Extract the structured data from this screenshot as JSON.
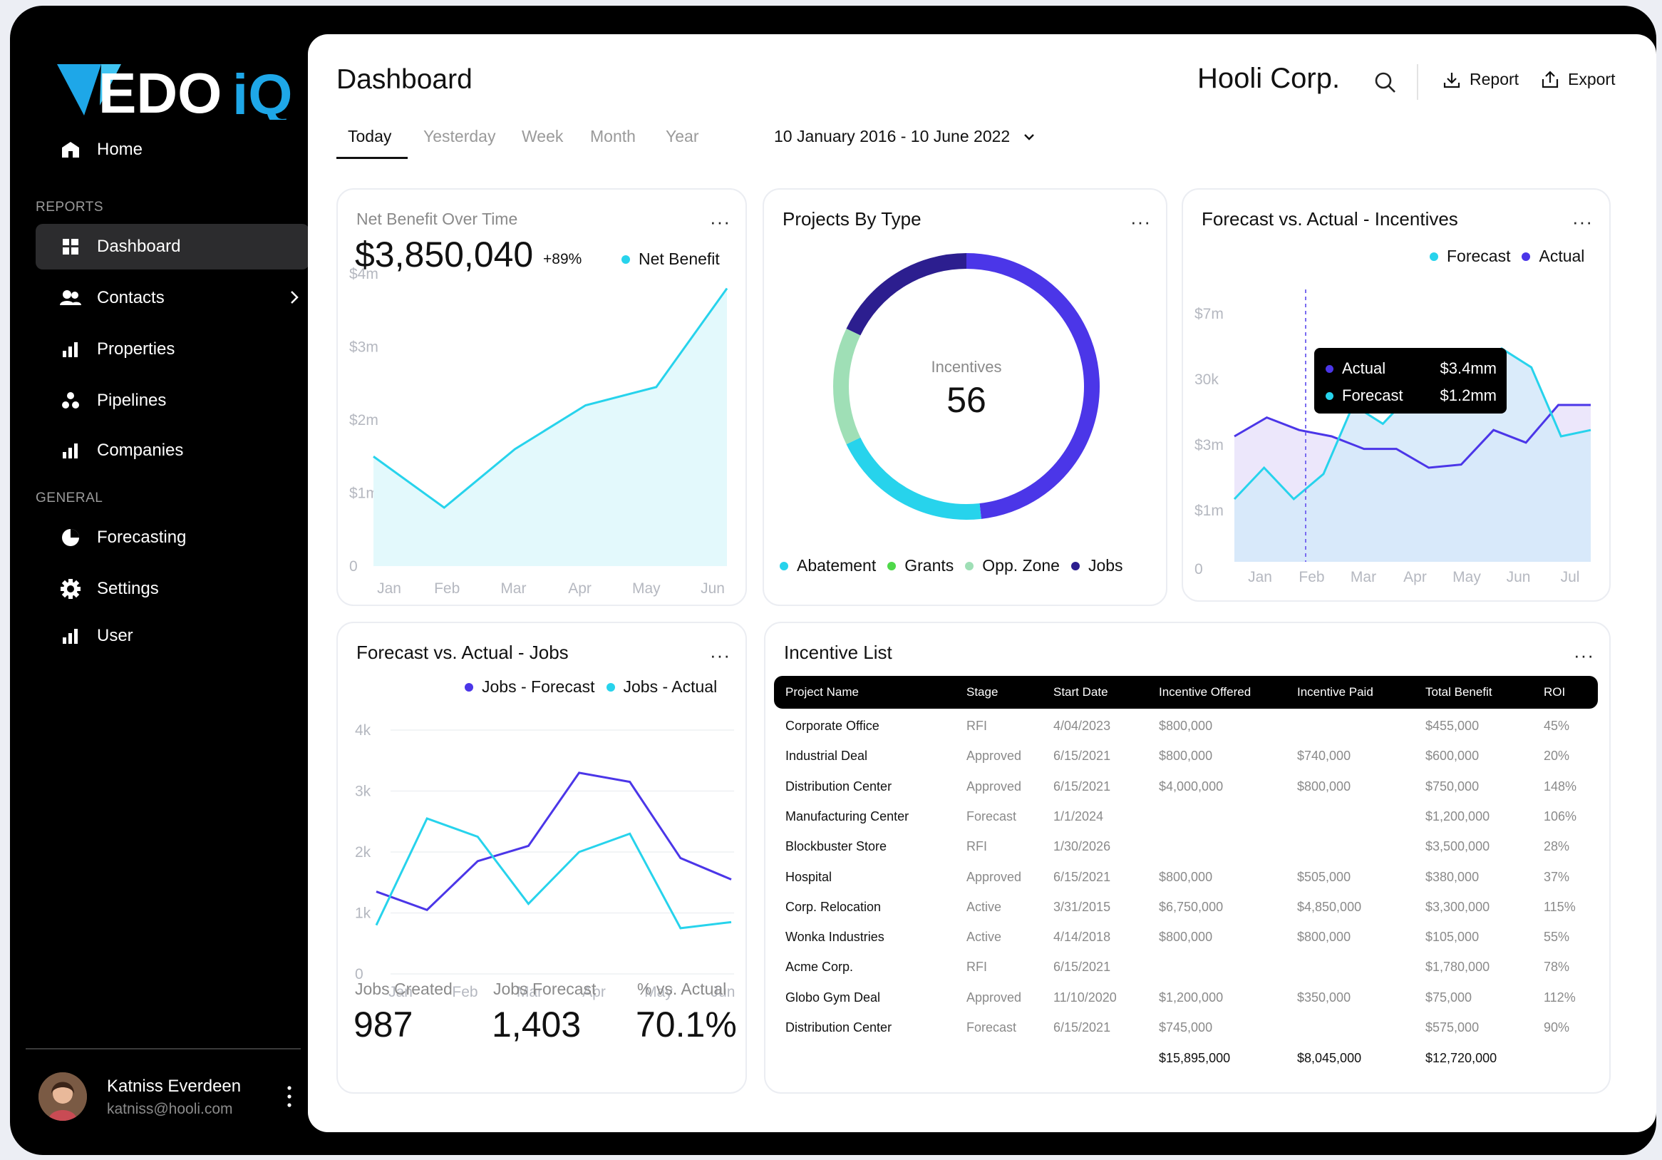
{
  "sidebar": {
    "logo_text": "EDOiQ",
    "items": [
      {
        "label": "Home"
      },
      {
        "label": "Dashboard"
      },
      {
        "label": "Contacts"
      },
      {
        "label": "Properties"
      },
      {
        "label": "Pipelines"
      },
      {
        "label": "Companies"
      },
      {
        "label": "Forecasting"
      },
      {
        "label": "Settings"
      },
      {
        "label": "User"
      }
    ],
    "section_reports": "REPORTS",
    "section_general": "GENERAL",
    "active_item": "Dashboard",
    "user": {
      "name": "Katniss Everdeen",
      "email": "katniss@hooli.com"
    }
  },
  "header": {
    "title": "Dashboard",
    "company": "Hooli Corp.",
    "report_label": "Report",
    "export_label": "Export"
  },
  "tabs": [
    {
      "label": "Today"
    },
    {
      "label": "Yesterday"
    },
    {
      "label": "Week"
    },
    {
      "label": "Month"
    },
    {
      "label": "Year"
    }
  ],
  "active_tab": "Today",
  "date_range": "10 January 2016 - 10 June 2022",
  "colors": {
    "cyan": "#27d3ec",
    "indigo": "#4b36e8",
    "navy": "#2c1e8f",
    "green": "#4fd84a",
    "mint": "#9fdfb6"
  },
  "net_benefit": {
    "title": "Net Benefit Over Time",
    "value": "$3,850,040",
    "delta": "+89%",
    "legend": "Net Benefit",
    "menu": "···"
  },
  "projects_by_type": {
    "title": "Projects By Type",
    "center_label": "Incentives",
    "center_value": "56",
    "legend": [
      "Abatement",
      "Grants",
      "Opp. Zone",
      "Jobs"
    ],
    "menu": "···"
  },
  "forecast_incentives": {
    "title": "Forecast vs. Actual - Incentives",
    "legend": [
      "Forecast",
      "Actual"
    ],
    "tooltip": {
      "actual_label": "Actual",
      "actual_value": "$3.4mm",
      "forecast_label": "Forecast",
      "forecast_value": "$1.2mm"
    },
    "menu": "···"
  },
  "forecast_jobs": {
    "title": "Forecast vs. Actual - Jobs",
    "legend": [
      "Jobs - Forecast",
      "Jobs - Actual"
    ],
    "menu": "···",
    "stats": [
      {
        "label": "Jobs Created",
        "value": "987"
      },
      {
        "label": "Jobs Forecast",
        "value": "1,403"
      },
      {
        "label": "% vs. Actual",
        "value": "70.1%"
      }
    ]
  },
  "incentive_list": {
    "title": "Incentive List",
    "menu": "···",
    "columns": [
      "Project Name",
      "Stage",
      "Start Date",
      "Incentive Offered",
      "Incentive Paid",
      "Total Benefit",
      "ROI"
    ],
    "rows": [
      [
        "Corporate Office",
        "RFI",
        "4/04/2023",
        "$800,000",
        "",
        "$455,000",
        "45%"
      ],
      [
        "Industrial Deal",
        "Approved",
        "6/15/2021",
        "$800,000",
        "$740,000",
        "$600,000",
        "20%"
      ],
      [
        "Distribution Center",
        "Approved",
        "6/15/2021",
        "$4,000,000",
        "$800,000",
        "$750,000",
        "148%"
      ],
      [
        "Manufacturing Center",
        "Forecast",
        "1/1/2024",
        "",
        "",
        "$1,200,000",
        "106%"
      ],
      [
        "Blockbuster Store",
        "RFI",
        "1/30/2026",
        "",
        "",
        "$3,500,000",
        "28%"
      ],
      [
        "Hospital",
        "Approved",
        "6/15/2021",
        "$800,000",
        "$505,000",
        "$380,000",
        "37%"
      ],
      [
        "Corp. Relocation",
        "Active",
        "3/31/2015",
        "$6,750,000",
        "$4,850,000",
        "$3,300,000",
        "115%"
      ],
      [
        "Wonka Industries",
        "Active",
        "4/14/2018",
        "$800,000",
        "$800,000",
        "$105,000",
        "55%"
      ],
      [
        "Acme Corp.",
        "RFI",
        "6/15/2021",
        "",
        "",
        "$1,780,000",
        "78%"
      ],
      [
        "Globo Gym Deal",
        "Approved",
        "11/10/2020",
        "$1,200,000",
        "$350,000",
        "$75,000",
        "112%"
      ],
      [
        "Distribution Center",
        "Forecast",
        "6/15/2021",
        "$745,000",
        "",
        "$575,000",
        "90%"
      ]
    ],
    "totals": {
      "offered": "$15,895,000",
      "paid": "$8,045,000",
      "benefit": "$12,720,000"
    }
  },
  "chart_data": [
    {
      "type": "area",
      "title": "Net Benefit Over Time",
      "categories": [
        "Jan",
        "Feb",
        "Mar",
        "Apr",
        "May",
        "Jun"
      ],
      "y_ticks": [
        "0",
        "$1m",
        "$2m",
        "$3m",
        "$4m"
      ],
      "ylim": [
        0,
        4000000
      ],
      "series": [
        {
          "name": "Net Benefit",
          "values": [
            1500000,
            800000,
            1600000,
            2200000,
            2450000,
            3800000
          ]
        }
      ]
    },
    {
      "type": "pie",
      "title": "Projects By Type",
      "series": [
        {
          "name": "Abatement",
          "value": 11
        },
        {
          "name": "Grants",
          "value": 0
        },
        {
          "name": "Opp. Zone",
          "value": 8
        },
        {
          "name": "Jobs",
          "value": 37
        }
      ]
    },
    {
      "type": "area",
      "title": "Forecast vs. Actual - Incentives",
      "categories": [
        "Jan",
        "Feb",
        "Mar",
        "Apr",
        "May",
        "Jun",
        "Jul"
      ],
      "y_ticks": [
        "0",
        "$1m",
        "$3m",
        "30k",
        "$7m"
      ],
      "y_tick_positions": [
        0,
        1,
        2,
        3,
        4
      ],
      "ylim": [
        0,
        4
      ],
      "series": [
        {
          "name": "Forecast",
          "values": [
            1.0,
            1.5,
            1.0,
            1.4,
            2.5,
            2.2,
            2.7,
            2.9,
            3.1,
            3.4,
            3.1,
            2.0,
            2.1
          ]
        },
        {
          "name": "Actual",
          "values": [
            2.0,
            2.3,
            2.1,
            2.0,
            1.8,
            1.8,
            1.5,
            1.55,
            2.1,
            1.9,
            2.5,
            2.5
          ]
        }
      ]
    },
    {
      "type": "line",
      "title": "Forecast vs. Actual - Jobs",
      "categories": [
        "Jan",
        "Feb",
        "Mar",
        "Apr",
        "May",
        "Jun"
      ],
      "y_ticks": [
        "0",
        "1k",
        "2k",
        "3k",
        "4k"
      ],
      "ylim": [
        0,
        4000
      ],
      "series": [
        {
          "name": "Jobs - Forecast",
          "values": [
            1350,
            1050,
            1850,
            2100,
            3300,
            3150,
            1900,
            1550
          ]
        },
        {
          "name": "Jobs - Actual",
          "values": [
            800,
            2550,
            2250,
            1150,
            2000,
            2300,
            750,
            850
          ]
        }
      ]
    }
  ]
}
